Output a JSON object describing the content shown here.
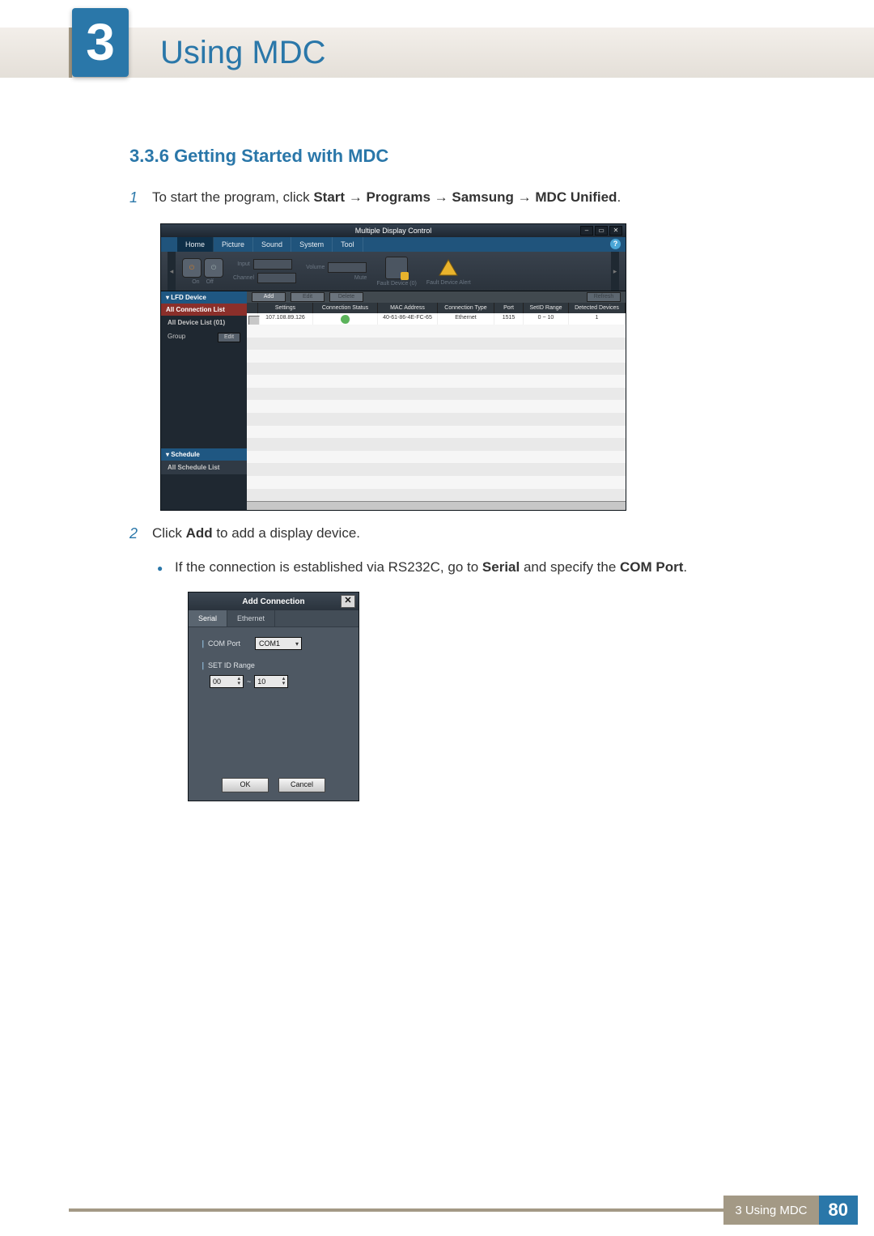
{
  "chapter": {
    "number": "3",
    "title": "Using MDC"
  },
  "section": {
    "number": "3.3.6",
    "title": "Getting Started with MDC"
  },
  "steps": {
    "s1": {
      "num": "1",
      "text_pre": "To start the program, click ",
      "b1": "Start",
      "arrow1": " → ",
      "b2": "Programs",
      "arrow2": " → ",
      "b3": "Samsung",
      "arrow3": " → ",
      "b4": "MDC Unified",
      "tail": "."
    },
    "s2": {
      "num": "2",
      "text_pre": "Click ",
      "bold": "Add",
      "text_post": " to add a display device."
    },
    "bullet": {
      "pre": "If the connection is established via RS232C, go to ",
      "b1": "Serial",
      "mid": " and specify the ",
      "b2": "COM Port",
      "tail": "."
    }
  },
  "mdc": {
    "title": "Multiple Display Control",
    "tabs": [
      "Home",
      "Picture",
      "Sound",
      "System",
      "Tool"
    ],
    "toolbar": {
      "on": "On",
      "off": "Off",
      "input": "Input",
      "channel": "Channel",
      "volume": "Volume",
      "mute": "Mute",
      "fdn": "Fault Device (0)",
      "fda": "Fault Device Alert"
    },
    "side": {
      "lfd": "LFD Device",
      "all_conn": "All Connection List",
      "all_dev": "All Device List (01)",
      "group": "Group",
      "edit": "Edit",
      "schedule": "Schedule",
      "all_sched": "All Schedule List"
    },
    "btns": {
      "add": "Add",
      "edit": "Edit",
      "delete": "Delete",
      "refresh": "Refresh"
    },
    "cols": [
      "",
      "Settings",
      "Connection Status",
      "MAC Address",
      "Connection Type",
      "Port",
      "SetID Range",
      "Detected Devices"
    ],
    "row": [
      "",
      "107.108.89.126",
      "●",
      "40-61-86-4E-FC-65",
      "Ethernet",
      "1515",
      "0 ~ 10",
      "1"
    ]
  },
  "dlg": {
    "title": "Add Connection",
    "tabs": {
      "serial": "Serial",
      "ethernet": "Ethernet"
    },
    "com_port_label": "COM Port",
    "com_port_value": "COM1",
    "setid_label": "SET ID Range",
    "spin_from": "00",
    "spin_sep": "~",
    "spin_to": "10",
    "ok": "OK",
    "cancel": "Cancel"
  },
  "footer": {
    "label": "3 Using MDC",
    "page": "80"
  }
}
